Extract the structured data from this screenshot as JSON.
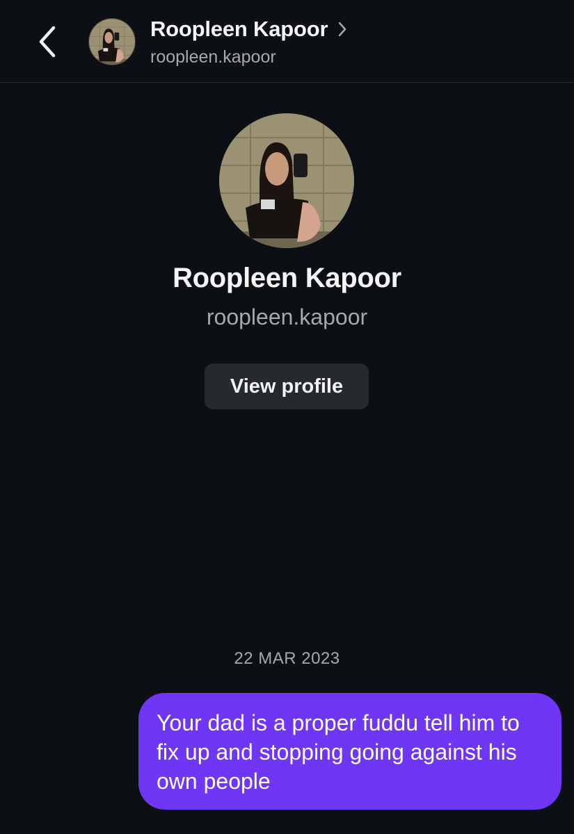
{
  "header": {
    "back_icon": "chevron-left-icon",
    "name": "Roopleen Kapoor",
    "chevron_icon": "chevron-right-icon",
    "handle": "roopleen.kapoor"
  },
  "profile": {
    "name": "Roopleen Kapoor",
    "handle": "roopleen.kapoor",
    "view_profile_label": "View profile"
  },
  "chat": {
    "date": "22 MAR 2023",
    "messages": [
      {
        "sender": "me",
        "text": "Your dad is a proper fuddu tell him to fix up and stopping going against his own people"
      }
    ]
  },
  "colors": {
    "background": "#0c1014",
    "bubble": "#7036f5",
    "button": "#262a2f",
    "muted_text": "#a8a8a8"
  }
}
